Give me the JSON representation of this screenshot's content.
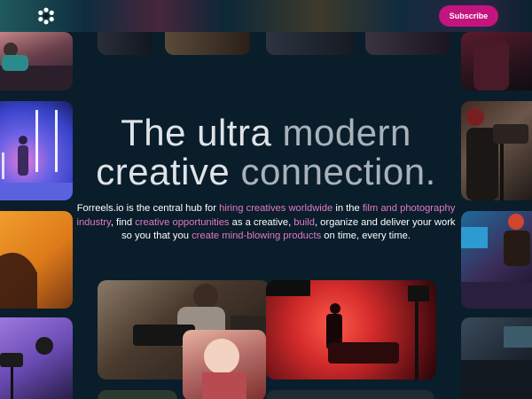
{
  "header": {
    "logo_icon": "flower-logo-icon",
    "subscribe_label": "Subscribe",
    "accent_color": "#c4147f"
  },
  "hero": {
    "title_line1_a": "The ultra ",
    "title_line1_b": "modern",
    "title_line2_a": "creative ",
    "title_line2_b": "connection.",
    "desc": {
      "p1": "Forreels.io is the central hub for ",
      "l1": "hiring creatives worldwide",
      "p2": " in the ",
      "l2": "film and photography industry",
      "p3": ", find ",
      "l3": "creative opportunities",
      "p4": " as a creative, ",
      "l4": "build",
      "p5": ", organize and deliver your work so you that you ",
      "l5": "create mind-blowing products",
      "p6": " on time, every time."
    },
    "link_color": "#e07ac6"
  },
  "gallery": {
    "left_images": [
      "photo-couch",
      "photo-dancer-stage",
      "photo-orange-portrait",
      "photo-studio-lights"
    ],
    "right_images": [
      "photo-red-portrait",
      "photo-camera-operator",
      "photo-editing-suite",
      "photo-monitors"
    ],
    "bottom_images": [
      "photo-camera-rig",
      "photo-red-set",
      "photo-headphones-portrait"
    ]
  }
}
